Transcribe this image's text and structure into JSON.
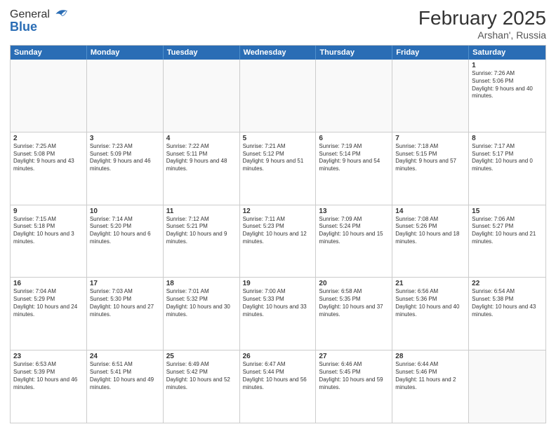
{
  "header": {
    "logo_general": "General",
    "logo_blue": "Blue",
    "month_title": "February 2025",
    "location": "Arshan', Russia"
  },
  "weekdays": [
    "Sunday",
    "Monday",
    "Tuesday",
    "Wednesday",
    "Thursday",
    "Friday",
    "Saturday"
  ],
  "rows": [
    [
      {
        "day": "",
        "info": ""
      },
      {
        "day": "",
        "info": ""
      },
      {
        "day": "",
        "info": ""
      },
      {
        "day": "",
        "info": ""
      },
      {
        "day": "",
        "info": ""
      },
      {
        "day": "",
        "info": ""
      },
      {
        "day": "1",
        "info": "Sunrise: 7:26 AM\nSunset: 5:06 PM\nDaylight: 9 hours and 40 minutes."
      }
    ],
    [
      {
        "day": "2",
        "info": "Sunrise: 7:25 AM\nSunset: 5:08 PM\nDaylight: 9 hours and 43 minutes."
      },
      {
        "day": "3",
        "info": "Sunrise: 7:23 AM\nSunset: 5:09 PM\nDaylight: 9 hours and 46 minutes."
      },
      {
        "day": "4",
        "info": "Sunrise: 7:22 AM\nSunset: 5:11 PM\nDaylight: 9 hours and 48 minutes."
      },
      {
        "day": "5",
        "info": "Sunrise: 7:21 AM\nSunset: 5:12 PM\nDaylight: 9 hours and 51 minutes."
      },
      {
        "day": "6",
        "info": "Sunrise: 7:19 AM\nSunset: 5:14 PM\nDaylight: 9 hours and 54 minutes."
      },
      {
        "day": "7",
        "info": "Sunrise: 7:18 AM\nSunset: 5:15 PM\nDaylight: 9 hours and 57 minutes."
      },
      {
        "day": "8",
        "info": "Sunrise: 7:17 AM\nSunset: 5:17 PM\nDaylight: 10 hours and 0 minutes."
      }
    ],
    [
      {
        "day": "9",
        "info": "Sunrise: 7:15 AM\nSunset: 5:18 PM\nDaylight: 10 hours and 3 minutes."
      },
      {
        "day": "10",
        "info": "Sunrise: 7:14 AM\nSunset: 5:20 PM\nDaylight: 10 hours and 6 minutes."
      },
      {
        "day": "11",
        "info": "Sunrise: 7:12 AM\nSunset: 5:21 PM\nDaylight: 10 hours and 9 minutes."
      },
      {
        "day": "12",
        "info": "Sunrise: 7:11 AM\nSunset: 5:23 PM\nDaylight: 10 hours and 12 minutes."
      },
      {
        "day": "13",
        "info": "Sunrise: 7:09 AM\nSunset: 5:24 PM\nDaylight: 10 hours and 15 minutes."
      },
      {
        "day": "14",
        "info": "Sunrise: 7:08 AM\nSunset: 5:26 PM\nDaylight: 10 hours and 18 minutes."
      },
      {
        "day": "15",
        "info": "Sunrise: 7:06 AM\nSunset: 5:27 PM\nDaylight: 10 hours and 21 minutes."
      }
    ],
    [
      {
        "day": "16",
        "info": "Sunrise: 7:04 AM\nSunset: 5:29 PM\nDaylight: 10 hours and 24 minutes."
      },
      {
        "day": "17",
        "info": "Sunrise: 7:03 AM\nSunset: 5:30 PM\nDaylight: 10 hours and 27 minutes."
      },
      {
        "day": "18",
        "info": "Sunrise: 7:01 AM\nSunset: 5:32 PM\nDaylight: 10 hours and 30 minutes."
      },
      {
        "day": "19",
        "info": "Sunrise: 7:00 AM\nSunset: 5:33 PM\nDaylight: 10 hours and 33 minutes."
      },
      {
        "day": "20",
        "info": "Sunrise: 6:58 AM\nSunset: 5:35 PM\nDaylight: 10 hours and 37 minutes."
      },
      {
        "day": "21",
        "info": "Sunrise: 6:56 AM\nSunset: 5:36 PM\nDaylight: 10 hours and 40 minutes."
      },
      {
        "day": "22",
        "info": "Sunrise: 6:54 AM\nSunset: 5:38 PM\nDaylight: 10 hours and 43 minutes."
      }
    ],
    [
      {
        "day": "23",
        "info": "Sunrise: 6:53 AM\nSunset: 5:39 PM\nDaylight: 10 hours and 46 minutes."
      },
      {
        "day": "24",
        "info": "Sunrise: 6:51 AM\nSunset: 5:41 PM\nDaylight: 10 hours and 49 minutes."
      },
      {
        "day": "25",
        "info": "Sunrise: 6:49 AM\nSunset: 5:42 PM\nDaylight: 10 hours and 52 minutes."
      },
      {
        "day": "26",
        "info": "Sunrise: 6:47 AM\nSunset: 5:44 PM\nDaylight: 10 hours and 56 minutes."
      },
      {
        "day": "27",
        "info": "Sunrise: 6:46 AM\nSunset: 5:45 PM\nDaylight: 10 hours and 59 minutes."
      },
      {
        "day": "28",
        "info": "Sunrise: 6:44 AM\nSunset: 5:46 PM\nDaylight: 11 hours and 2 minutes."
      },
      {
        "day": "",
        "info": ""
      }
    ]
  ]
}
